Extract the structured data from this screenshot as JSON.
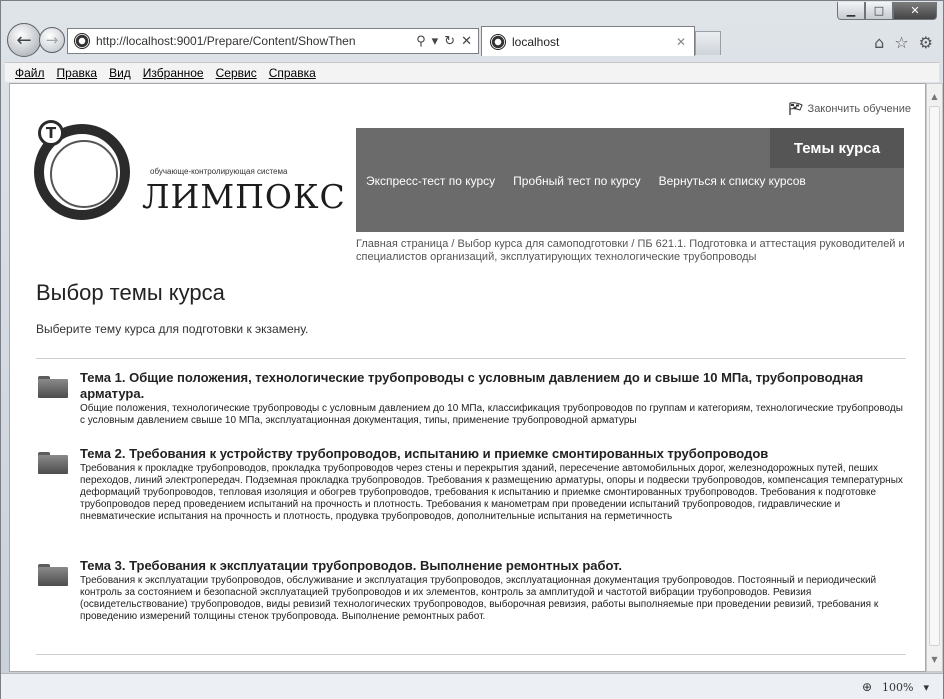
{
  "browser": {
    "url": "http://localhost:9001/Prepare/Content/ShowThen",
    "url_host": "localhost",
    "tab_title": "localhost",
    "menu": [
      "Файл",
      "Правка",
      "Вид",
      "Избранное",
      "Сервис",
      "Справка"
    ],
    "zoom": "100%"
  },
  "page": {
    "finish_link": "Закончить обучение",
    "logo": {
      "tagline": "обучающе-контролирующая система",
      "name": "ЛИМПОКС",
      "badge": "Т"
    },
    "nav": {
      "active": "Темы курса",
      "links": [
        "Экспресс-тест по курсу",
        "Пробный тест по курсу",
        "Вернуться к списку курсов"
      ]
    },
    "breadcrumb": "Главная страница  /  Выбор курса для самоподготовки  /  ПБ 621.1. Подготовка и аттестация руководителей и специалистов организаций, эксплуатирующих технологические трубопроводы",
    "title": "Выбор темы курса",
    "intro": "Выберите тему курса для подготовки к экзамену.",
    "topics": [
      {
        "title": "Тема 1. Общие положения, технологические трубопроводы с условным давлением до и свыше 10 МПа, трубопроводная арматура.",
        "desc": "Общие положения, технологические трубопроводы с условным давлением до 10 МПа, классификация трубопроводов по группам и категориям, технологические трубопроводы с условным давлением свыше 10 МПа,  эксплуатационная документация, типы, применение трубопроводной арматуры"
      },
      {
        "title": "Тема 2. Требования к устройству трубопроводов, испытанию и приемке смонтированных трубопроводов",
        "desc": "Требования к прокладке трубопроводов, прокладка трубопроводов через стены и перекрытия зданий, пересечение автомобильных дорог, железнодорожных путей, пеших переходов, линий электропередач. Подземная прокладка трубопроводов. Требования к размещению арматуры, опоры и подвески трубопроводов, компенсация температурных деформаций трубопроводов, тепловая изоляция и обогрев трубопроводов, требования к испытанию и приемке смонтированных трубопроводов. Требования к подготовке трубопроводов перед проведением испытаний на прочность и плотность. Требования к манометрам при проведении испытаний трубопроводов, гидравлические и пневматические испытания на прочность и плотность, продувка трубопроводов, дополнительные испытания на герметичность"
      },
      {
        "title": "Тема 3. Требования к эксплуатации трубопроводов. Выполнение ремонтных работ.",
        "desc": "Требования к эксплуатации трубопроводов, обслуживание и эксплуатация трубопроводов, эксплуатационная документация трубопроводов. Постоянный и периодический контроль за состоянием и безопасной эксплуатацией трубопроводов и их элементов, контроль за амплитудой и частотой вибрации трубопроводов. Ревизия (освидетельствование) трубопроводов, виды ревизий технологических трубопроводов, выборочная ревизия, работы выполняемые при проведении ревизий, требования к проведению измерений толщины стенок трубопровода. Выполнение ремонтных работ."
      }
    ]
  }
}
